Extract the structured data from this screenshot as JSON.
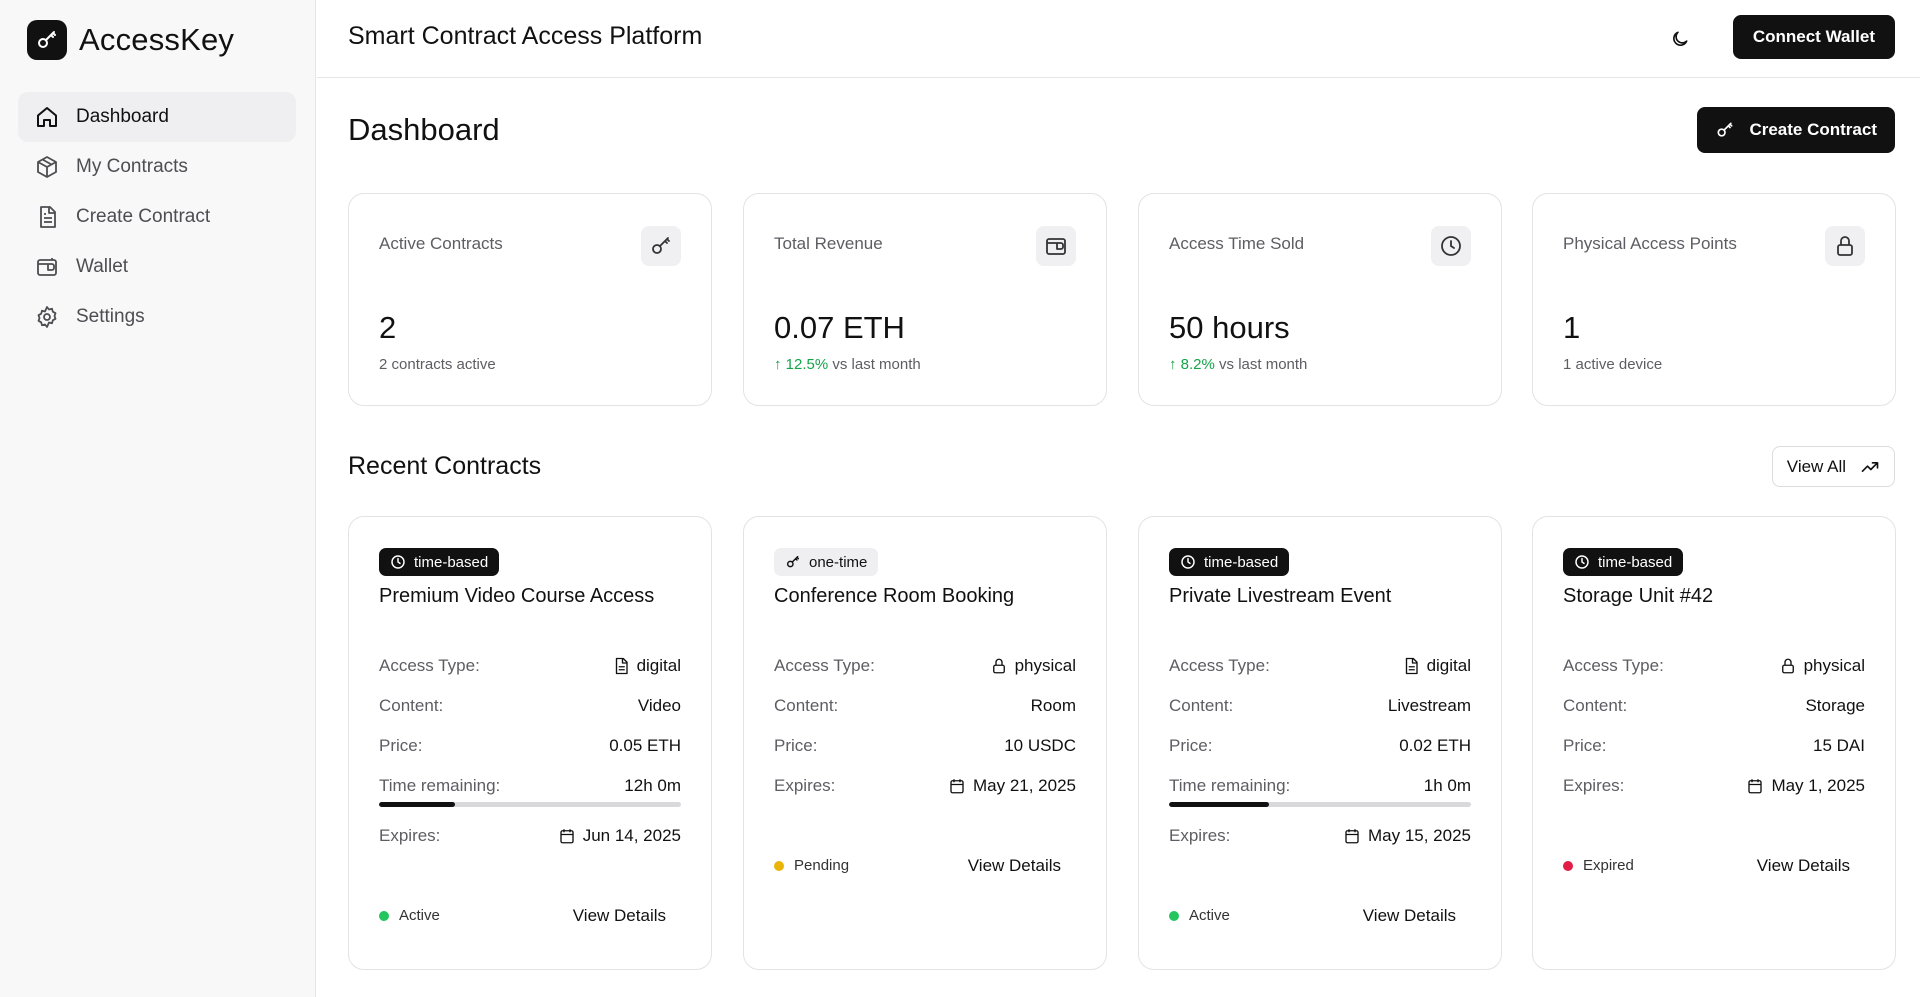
{
  "app": {
    "name": "AccessKey",
    "title": "Smart Contract Access Platform"
  },
  "nav": [
    {
      "label": "Dashboard",
      "icon": "home-icon",
      "active": true
    },
    {
      "label": "My Contracts",
      "icon": "box-icon",
      "active": false
    },
    {
      "label": "Create Contract",
      "icon": "document-icon",
      "active": false
    },
    {
      "label": "Wallet",
      "icon": "wallet-icon",
      "active": false
    },
    {
      "label": "Settings",
      "icon": "gear-icon",
      "active": false
    }
  ],
  "header": {
    "connect_label": "Connect Wallet"
  },
  "page": {
    "title": "Dashboard",
    "create_label": "Create Contract"
  },
  "stats": [
    {
      "label": "Active Contracts",
      "value": "2",
      "sub": "2 contracts active",
      "icon": "key-icon"
    },
    {
      "label": "Total Revenue",
      "value": "0.07 ETH",
      "change": "↑ 12.5%",
      "sub": " vs last month",
      "icon": "wallet-icon"
    },
    {
      "label": "Access Time Sold",
      "value": "50 hours",
      "change": "↑ 8.2%",
      "sub": " vs last month",
      "icon": "clock-icon"
    },
    {
      "label": "Physical Access Points",
      "value": "1",
      "sub": "1 active device",
      "icon": "lock-icon"
    }
  ],
  "recent": {
    "title": "Recent Contracts",
    "view_all": "View All"
  },
  "contracts": [
    {
      "badge": "time-based",
      "title": "Premium Video Course Access",
      "access_type_label": "Access Type:",
      "access_type": "digital",
      "content_label": "Content:",
      "content": "Video",
      "price_label": "Price:",
      "price": "0.05 ETH",
      "time_label": "Time remaining:",
      "time": "12h 0m",
      "progress": 0.25,
      "expires_label": "Expires:",
      "expires": "Jun 14, 2025",
      "status": "Active",
      "status_color": "#22c55e",
      "details": "View Details"
    },
    {
      "badge": "one-time",
      "title": "Conference Room Booking",
      "access_type_label": "Access Type:",
      "access_type": "physical",
      "content_label": "Content:",
      "content": "Room",
      "price_label": "Price:",
      "price": "10 USDC",
      "expires_label": "Expires:",
      "expires": "May 21, 2025",
      "status": "Pending",
      "status_color": "#eab308",
      "details": "View Details"
    },
    {
      "badge": "time-based",
      "title": "Private Livestream Event",
      "access_type_label": "Access Type:",
      "access_type": "digital",
      "content_label": "Content:",
      "content": "Livestream",
      "price_label": "Price:",
      "price": "0.02 ETH",
      "time_label": "Time remaining:",
      "time": "1h 0m",
      "progress": 0.33,
      "expires_label": "Expires:",
      "expires": "May 15, 2025",
      "status": "Active",
      "status_color": "#22c55e",
      "details": "View Details"
    },
    {
      "badge": "time-based",
      "title": "Storage Unit #42",
      "access_type_label": "Access Type:",
      "access_type": "physical",
      "content_label": "Content:",
      "content": "Storage",
      "price_label": "Price:",
      "price": "15 DAI",
      "expires_label": "Expires:",
      "expires": "May 1, 2025",
      "status": "Expired",
      "status_color": "#e11d48",
      "details": "View Details"
    }
  ]
}
